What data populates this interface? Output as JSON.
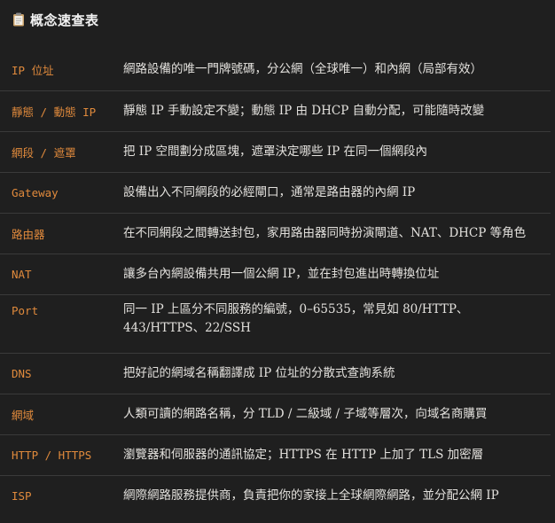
{
  "header": {
    "icon": "clipboard-icon",
    "title": "概念速查表"
  },
  "rows": [
    {
      "term": "IP 位址",
      "desc": "網路設備的唯一門牌號碼，分公網（全球唯一）和內網（局部有效）"
    },
    {
      "term": "靜態 / 動態 IP",
      "desc": "靜態 IP 手動設定不變；動態 IP 由 DHCP 自動分配，可能隨時改變"
    },
    {
      "term": "網段 / 遮罩",
      "desc": "把 IP 空間劃分成區塊，遮罩決定哪些 IP 在同一個網段內"
    },
    {
      "term": "Gateway",
      "desc": "設備出入不同網段的必經閘口，通常是路由器的內網 IP"
    },
    {
      "term": "路由器",
      "desc": "在不同網段之間轉送封包，家用路由器同時扮演閘道、NAT、DHCP 等角色"
    },
    {
      "term": "NAT",
      "desc": "讓多台內網設備共用一個公網 IP，並在封包進出時轉換位址"
    },
    {
      "term": "Port",
      "desc": "同一 IP 上區分不同服務的編號，0–65535，常見如 80/HTTP、443/HTTPS、22/SSH"
    },
    {
      "term": "DNS",
      "desc": "把好記的網域名稱翻譯成 IP 位址的分散式查詢系統"
    },
    {
      "term": "網域",
      "desc": "人類可讀的網路名稱，分 TLD / 二級域 / 子域等層次，向域名商購買"
    },
    {
      "term": "HTTP / HTTPS",
      "desc": "瀏覽器和伺服器的通訊協定；HTTPS 在 HTTP 上加了 TLS 加密層"
    },
    {
      "term": "ISP",
      "desc": "網際網路服務提供商，負責把你的家接上全球網際網路，並分配公網 IP"
    }
  ]
}
